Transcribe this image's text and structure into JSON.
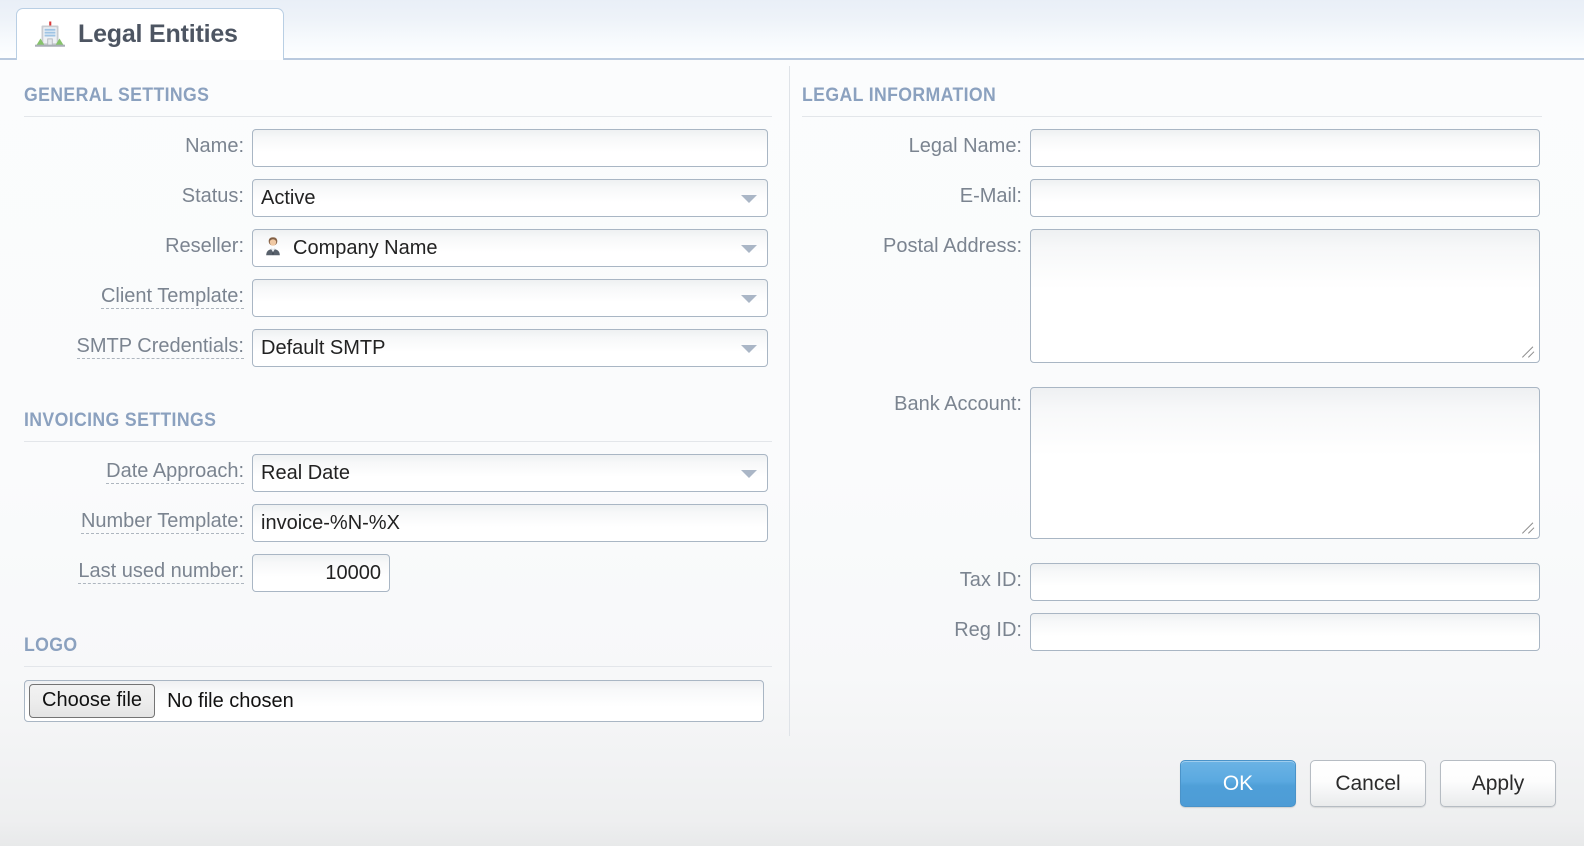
{
  "tab": {
    "title": "Legal Entities",
    "icon": "building-icon"
  },
  "sections": {
    "general": {
      "heading": "GENERAL SETTINGS",
      "fields": {
        "name": {
          "label": "Name:",
          "value": "",
          "type": "text"
        },
        "status": {
          "label": "Status:",
          "value": "Active",
          "type": "select"
        },
        "reseller": {
          "label": "Reseller:",
          "value": "Company Name",
          "type": "select",
          "icon": "user-avatar-icon"
        },
        "client_template": {
          "label": "Client Template:",
          "value": "",
          "type": "select",
          "hint": true
        },
        "smtp_credentials": {
          "label": "SMTP Credentials:",
          "value": "Default SMTP",
          "type": "select",
          "hint": true
        }
      }
    },
    "invoicing": {
      "heading": "INVOICING SETTINGS",
      "fields": {
        "date_approach": {
          "label": "Date Approach:",
          "value": "Real Date",
          "type": "select",
          "hint": true
        },
        "number_template": {
          "label": "Number Template:",
          "value": "invoice-%N-%X",
          "type": "text",
          "hint": true
        },
        "last_used_number": {
          "label": "Last used number:",
          "value": "10000",
          "type": "number",
          "hint": true
        }
      }
    },
    "logo": {
      "heading": "LOGO",
      "file": {
        "button_label": "Choose file",
        "status_text": "No file chosen"
      }
    },
    "legal": {
      "heading": "LEGAL INFORMATION",
      "fields": {
        "legal_name": {
          "label": "Legal Name:",
          "value": "",
          "type": "text"
        },
        "email": {
          "label": "E-Mail:",
          "value": "",
          "type": "text"
        },
        "postal_address": {
          "label": "Postal Address:",
          "value": "",
          "type": "textarea"
        },
        "bank_account": {
          "label": "Bank Account:",
          "value": "",
          "type": "textarea"
        },
        "tax_id": {
          "label": "Tax ID:",
          "value": "",
          "type": "text"
        },
        "reg_id": {
          "label": "Reg ID:",
          "value": "",
          "type": "text"
        }
      }
    }
  },
  "footer": {
    "ok": "OK",
    "cancel": "Cancel",
    "apply": "Apply"
  },
  "colors": {
    "accent": "#5aa9e0",
    "section_heading": "#8ba1bf",
    "label": "#7b8490",
    "field_border": "#a9b6c4",
    "tab_border": "#b9cfe4"
  }
}
